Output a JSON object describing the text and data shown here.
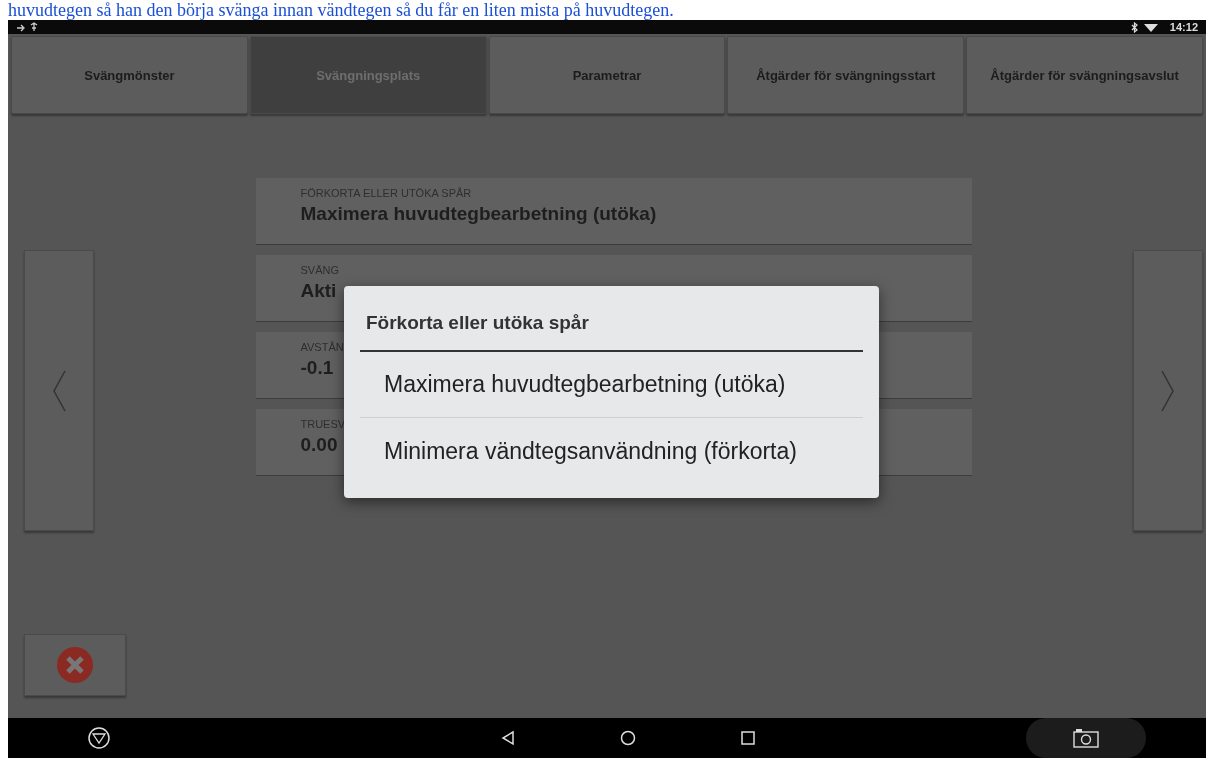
{
  "caption": "huvudtegen så han den börja svänga innan vändtegen så du får en liten mista på huvudtegen.",
  "status_bar": {
    "time": "14:12"
  },
  "tabs": [
    {
      "label": "Svängmönster",
      "selected": false
    },
    {
      "label": "Svängningsplats",
      "selected": true
    },
    {
      "label": "Parametrar",
      "selected": false
    },
    {
      "label": "Åtgärder för svängningsstart",
      "selected": false
    },
    {
      "label": "Åtgärder för svängningsavslut",
      "selected": false
    }
  ],
  "settings": [
    {
      "label": "FÖRKORTA ELLER UTÖKA SPÅR",
      "value": "Maximera huvudtegbearbetning (utöka)"
    },
    {
      "label": "SVÄNG",
      "value": "Akti"
    },
    {
      "label": "AVSTÅN",
      "value": "-0.1"
    },
    {
      "label": "TRUESV",
      "value": "0.00"
    }
  ],
  "dialog": {
    "title": "Förkorta eller utöka spår",
    "options": [
      "Maximera huvudtegbearbetning (utöka)",
      "Minimera vändtegsanvändning (förkorta)"
    ]
  }
}
